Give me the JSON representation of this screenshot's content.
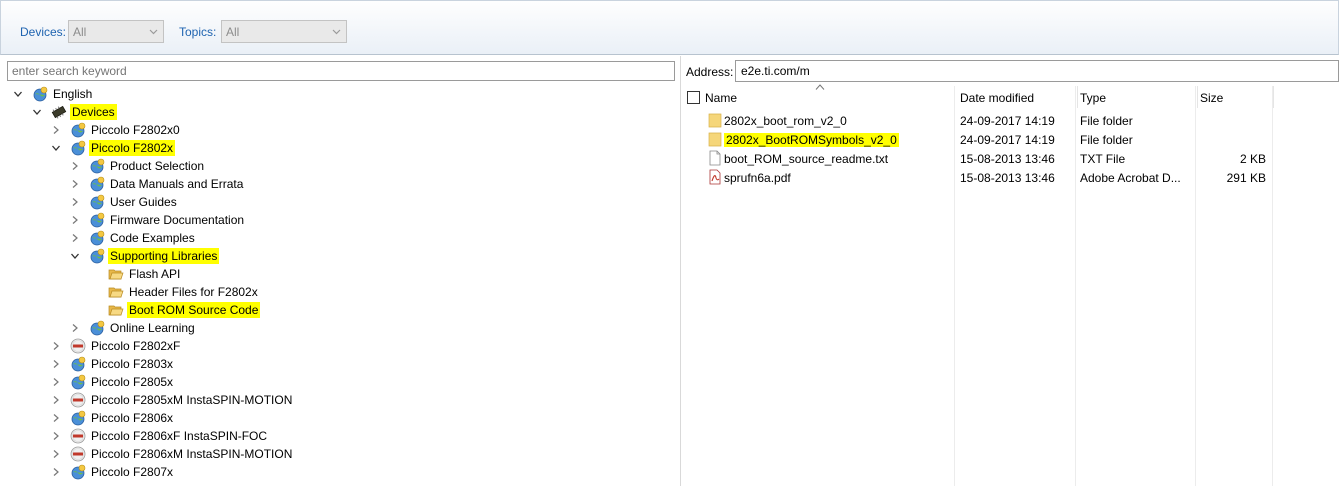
{
  "filters": {
    "devices_label": "Devices:",
    "devices_value": "All",
    "topics_label": "Topics:",
    "topics_value": "All"
  },
  "search": {
    "placeholder": "enter search keyword"
  },
  "tree": [
    {
      "label": "English",
      "level": 0,
      "expander": "expanded",
      "icon": "globe-pin-icon",
      "highlight": false
    },
    {
      "label": "Devices",
      "level": 1,
      "expander": "expanded",
      "icon": "chip-icon",
      "highlight": true
    },
    {
      "label": "Piccolo F2802x0",
      "level": 2,
      "expander": "collapsed",
      "icon": "globe-pin-icon",
      "highlight": false
    },
    {
      "label": "Piccolo F2802x",
      "level": 2,
      "expander": "expanded",
      "icon": "globe-pin-icon",
      "highlight": true
    },
    {
      "label": "Product Selection",
      "level": 3,
      "expander": "collapsed",
      "icon": "globe-pin-icon",
      "highlight": false
    },
    {
      "label": "Data Manuals and Errata",
      "level": 3,
      "expander": "collapsed",
      "icon": "globe-pin-icon",
      "highlight": false
    },
    {
      "label": "User Guides",
      "level": 3,
      "expander": "collapsed",
      "icon": "globe-pin-icon",
      "highlight": false
    },
    {
      "label": "Firmware Documentation",
      "level": 3,
      "expander": "collapsed",
      "icon": "globe-pin-icon",
      "highlight": false
    },
    {
      "label": "Code Examples",
      "level": 3,
      "expander": "collapsed",
      "icon": "globe-pin-icon",
      "highlight": false
    },
    {
      "label": "Supporting Libraries",
      "level": 3,
      "expander": "expanded",
      "icon": "globe-pin-icon",
      "highlight": true
    },
    {
      "label": "Flash API",
      "level": 4,
      "expander": "none",
      "icon": "open-folder-icon",
      "highlight": false
    },
    {
      "label": "Header Files for F2802x",
      "level": 4,
      "expander": "none",
      "icon": "open-folder-icon",
      "highlight": false
    },
    {
      "label": "Boot ROM Source Code",
      "level": 4,
      "expander": "none",
      "icon": "open-folder-icon",
      "highlight": true
    },
    {
      "label": "Online Learning",
      "level": 3,
      "expander": "collapsed",
      "icon": "globe-pin-icon",
      "highlight": false
    },
    {
      "label": "Piccolo F2802xF",
      "level": 2,
      "expander": "collapsed",
      "icon": "badge-icon",
      "highlight": false
    },
    {
      "label": "Piccolo F2803x",
      "level": 2,
      "expander": "collapsed",
      "icon": "globe-pin-icon",
      "highlight": false
    },
    {
      "label": "Piccolo F2805x",
      "level": 2,
      "expander": "collapsed",
      "icon": "globe-pin-icon",
      "highlight": false
    },
    {
      "label": "Piccolo F2805xM InstaSPIN-MOTION",
      "level": 2,
      "expander": "collapsed",
      "icon": "badge-icon",
      "highlight": false
    },
    {
      "label": "Piccolo F2806x",
      "level": 2,
      "expander": "collapsed",
      "icon": "globe-pin-icon",
      "highlight": false
    },
    {
      "label": "Piccolo F2806xF InstaSPIN-FOC",
      "level": 2,
      "expander": "collapsed",
      "icon": "badge-icon",
      "highlight": false
    },
    {
      "label": "Piccolo F2806xM InstaSPIN-MOTION",
      "level": 2,
      "expander": "collapsed",
      "icon": "badge-icon",
      "highlight": false
    },
    {
      "label": "Piccolo F2807x",
      "level": 2,
      "expander": "collapsed",
      "icon": "globe-pin-icon",
      "highlight": false
    }
  ],
  "address": {
    "label": "Address:",
    "value": "e2e.ti.com/m"
  },
  "columns": [
    "Name",
    "Date modified",
    "Type",
    "Size"
  ],
  "files": [
    {
      "name": "2802x_boot_rom_v2_0",
      "date": "24-09-2017 14:19",
      "type": "File folder",
      "size": "",
      "icon": "folder-icon",
      "highlight": false
    },
    {
      "name": "2802x_BootROMSymbols_v2_0",
      "date": "24-09-2017 14:19",
      "type": "File folder",
      "size": "",
      "icon": "folder-icon",
      "highlight": true
    },
    {
      "name": "boot_ROM_source_readme.txt",
      "date": "15-08-2013 13:46",
      "type": "TXT File",
      "size": "2 KB",
      "icon": "text-file-icon",
      "highlight": false
    },
    {
      "name": "sprufn6a.pdf",
      "date": "15-08-2013 13:46",
      "type": "Adobe Acrobat D...",
      "size": "291 KB",
      "icon": "pdf-file-icon",
      "highlight": false
    }
  ],
  "colors": {
    "link_blue": "#1e63b0",
    "highlight": "#ffff00",
    "folder": "#f5d67a"
  }
}
